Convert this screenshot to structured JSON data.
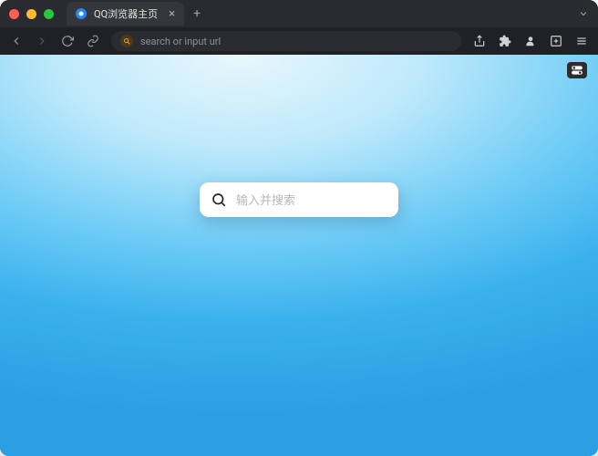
{
  "window": {
    "tab_title": "QQ浏览器主页",
    "new_tab": "+"
  },
  "toolbar": {
    "url_placeholder": "search or input url"
  },
  "page": {
    "search_placeholder": "输入并搜索"
  }
}
